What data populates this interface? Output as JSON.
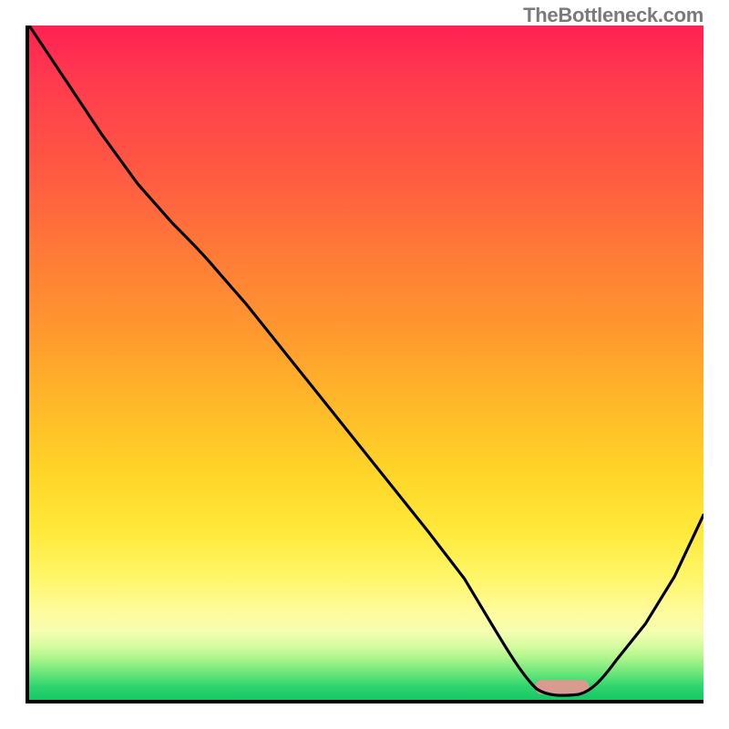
{
  "attribution": "TheBottleneck.com",
  "chart_data": {
    "type": "line",
    "title": "",
    "xlabel": "",
    "ylabel": "",
    "xlim": [
      0,
      100
    ],
    "ylim": [
      0,
      100
    ],
    "grid": false,
    "legend": false,
    "series": [
      {
        "name": "bottleneck-curve",
        "x": [
          0,
          5,
          10,
          15,
          20,
          25,
          30,
          35,
          40,
          45,
          50,
          55,
          60,
          64,
          68,
          72,
          75,
          78,
          82,
          86,
          90,
          95,
          100
        ],
        "y": [
          100,
          92,
          84,
          77,
          71,
          67,
          60,
          53,
          46,
          39,
          32,
          25,
          18,
          12,
          7,
          3,
          1,
          0,
          0,
          3,
          9,
          18,
          29
        ]
      }
    ],
    "marker": {
      "name": "optimal-range",
      "x_start": 75,
      "x_end": 82,
      "y": 0,
      "color": "#d99a8f"
    },
    "background_gradient_stops": [
      {
        "pos": 0.0,
        "color": "#ff2154"
      },
      {
        "pos": 0.5,
        "color": "#ffb829"
      },
      {
        "pos": 0.8,
        "color": "#fff66a"
      },
      {
        "pos": 0.92,
        "color": "#d6fca0"
      },
      {
        "pos": 1.0,
        "color": "#17c765"
      }
    ]
  }
}
